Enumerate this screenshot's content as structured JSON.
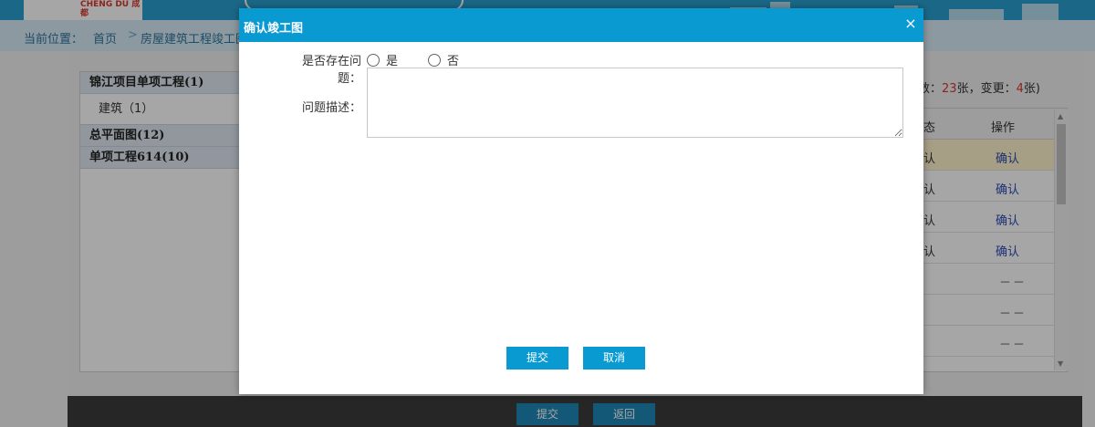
{
  "header": {
    "logo_text": "CHENG DU 成都"
  },
  "breadcrumb": {
    "label": "当前位置：",
    "home": "首页",
    "separator": ">",
    "current": "房屋建筑工程竣工图"
  },
  "tree": {
    "groups": [
      {
        "title": "锦江项目单项工程(1)",
        "children": [
          "建筑（1）"
        ]
      },
      {
        "title": "总平面图(12)",
        "children": []
      },
      {
        "title": "单项工程614(10)",
        "children": []
      }
    ]
  },
  "stats": {
    "prefix": "数：",
    "total": "23",
    "mid": "张，变更：",
    "changed": "4",
    "suffix": "张)"
  },
  "grid": {
    "headers": [
      "态",
      "操作"
    ],
    "rows": [
      {
        "status": "认",
        "action": "确认",
        "highlight": true
      },
      {
        "status": "认",
        "action": "确认",
        "highlight": false
      },
      {
        "status": "认",
        "action": "确认",
        "highlight": false
      },
      {
        "status": "认",
        "action": "确认",
        "highlight": false
      },
      {
        "status": "",
        "action": "－－",
        "highlight": false
      },
      {
        "status": "",
        "action": "－－",
        "highlight": false
      },
      {
        "status": "",
        "action": "－－",
        "highlight": false
      }
    ]
  },
  "footer": {
    "submit": "提交",
    "back": "返回"
  },
  "dialog": {
    "title": "确认竣工图",
    "close_icon": "×",
    "question_label": "是否存在问题：",
    "option_yes": "是",
    "option_no": "否",
    "description_label": "问题描述：",
    "description_value": "",
    "submit": "提交",
    "cancel": "取消"
  },
  "colors": {
    "accent": "#0a9ad2",
    "red": "#d8362c",
    "link": "#2b4bb5",
    "highlight_row": "#fff3cc"
  }
}
